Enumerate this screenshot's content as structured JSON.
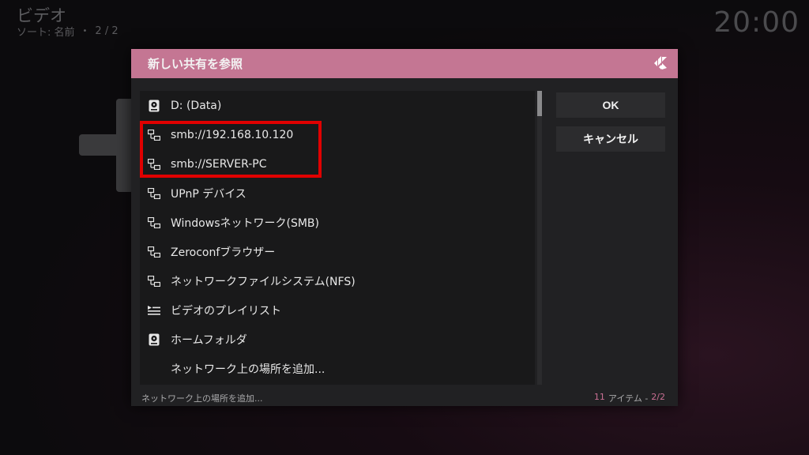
{
  "header": {
    "title": "ビデオ",
    "sort_label": "ソート: 名前",
    "separator": "•",
    "page": "2 / 2"
  },
  "clock": "20:00",
  "dialog": {
    "title": "新しい共有を参照",
    "logo_icon": "kodi-logo-icon",
    "items": [
      {
        "label": "D: (Data)",
        "icon": "harddisk-icon"
      },
      {
        "label": "smb://192.168.10.120",
        "icon": "network-icon"
      },
      {
        "label": "smb://SERVER-PC",
        "icon": "network-icon"
      },
      {
        "label": "UPnP デバイス",
        "icon": "network-icon"
      },
      {
        "label": "Windowsネットワーク(SMB)",
        "icon": "network-icon"
      },
      {
        "label": "Zeroconfブラウザー",
        "icon": "network-icon"
      },
      {
        "label": "ネットワークファイルシステム(NFS)",
        "icon": "network-icon"
      },
      {
        "label": "ビデオのプレイリスト",
        "icon": "playlist-icon"
      },
      {
        "label": "ホームフォルダ",
        "icon": "harddisk-icon"
      },
      {
        "label": "ネットワーク上の場所を追加...",
        "icon": ""
      }
    ],
    "buttons": {
      "ok": "OK",
      "cancel": "キャンセル"
    },
    "status": {
      "selected_label": "ネットワーク上の場所を追加...",
      "count": "11",
      "count_label": "アイテム -",
      "page": "2/2"
    }
  },
  "colors": {
    "header_bar": "#c47693",
    "accent": "#c96f93",
    "highlight": "#e00000"
  }
}
